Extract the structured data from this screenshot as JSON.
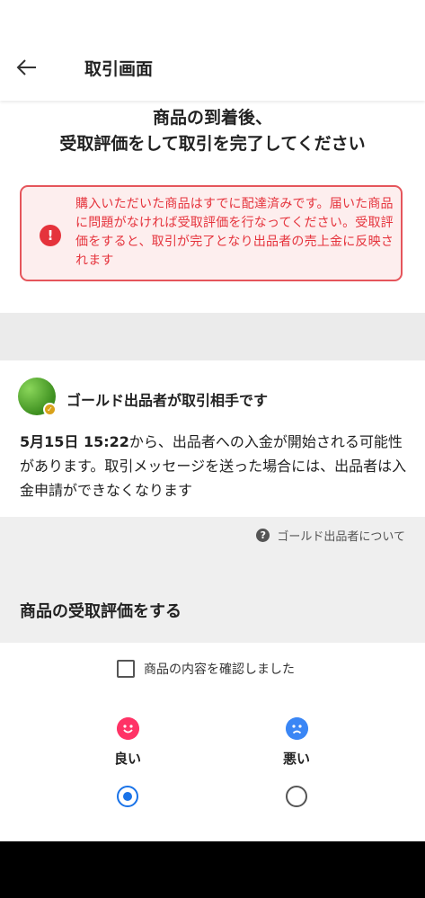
{
  "header": {
    "title": "取引画面",
    "back_icon": "arrow-left-icon"
  },
  "heading": {
    "line1": "商品の到着後、",
    "line2": "受取評価をして取引を完了してください"
  },
  "alert": {
    "icon": "exclamation-icon",
    "color": "#e5333c",
    "text": "購入いただいた商品はすでに配達済みです。届いた商品に問題がなければ受取評価を行なってください。受取評価をすると、取引が完了となり出品者の売上金に反映されます"
  },
  "seller": {
    "title": "ゴールド出品者が取引相手です",
    "notice_bold": "5月15日 15:22",
    "notice_rest": "から、出品者への入金が開始される可能性があります。取引メッセージを送った場合には、出品者は入金申請ができなくなります",
    "link": "ゴールド出品者について"
  },
  "rating": {
    "section_title": "商品の受取評価をする",
    "confirm_label": "商品の内容を確認しました",
    "confirm_checked": false,
    "good_label": "良い",
    "bad_label": "悪い",
    "selected": "good",
    "good_color": "#ff3366",
    "bad_color": "#3a86f5"
  }
}
